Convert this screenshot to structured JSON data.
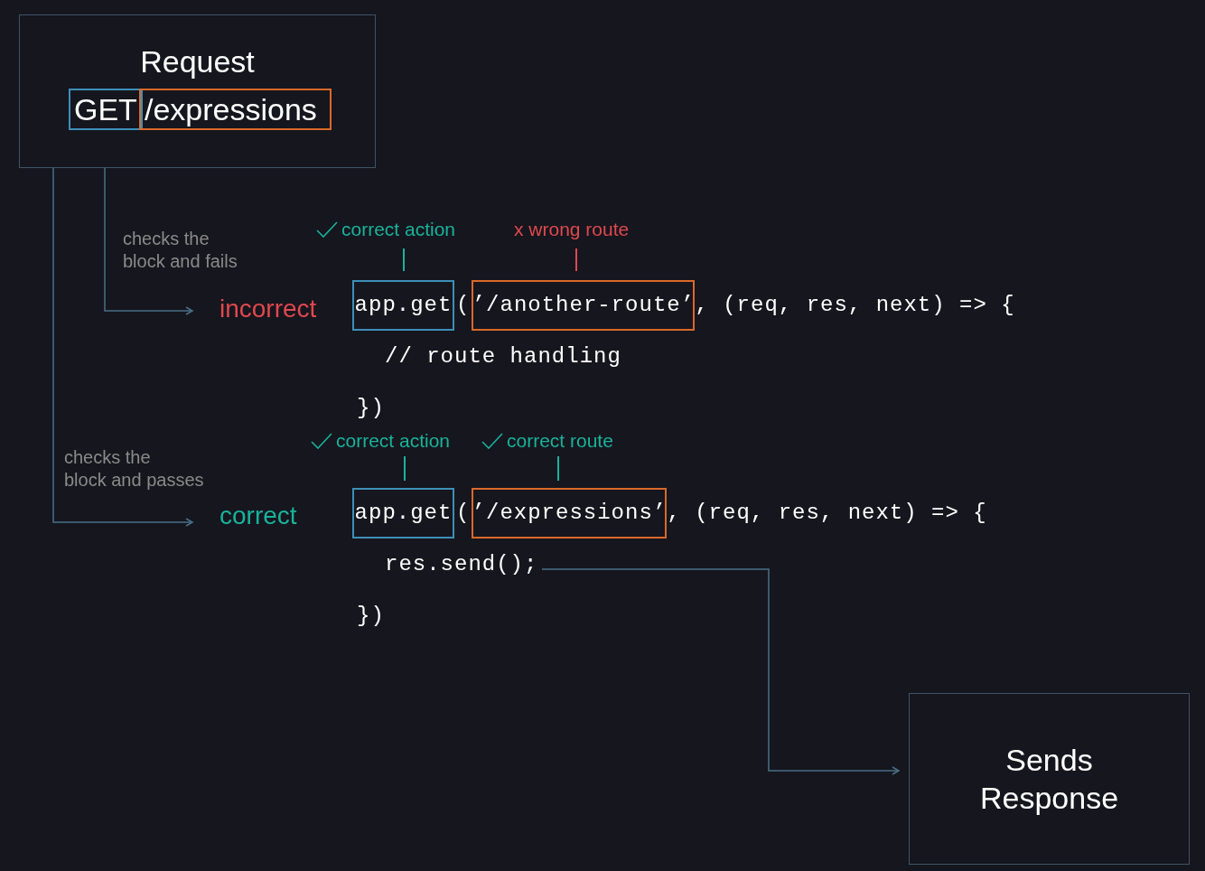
{
  "request": {
    "title": "Request",
    "method": "GET",
    "path": "/expressions"
  },
  "branches": [
    {
      "kind": "fail",
      "note_lines": [
        "checks the",
        "block and fails"
      ],
      "result": "incorrect",
      "annotations": [
        {
          "kind": "ok",
          "text": "correct action"
        },
        {
          "kind": "bad",
          "text": "x wrong route"
        }
      ],
      "code": {
        "action": "app.get",
        "paren": "(",
        "route": "’/another-route’",
        "rest": ", (req, res, next) => {",
        "body": "// route handling",
        "close": "})"
      }
    },
    {
      "kind": "pass",
      "note_lines": [
        "checks the",
        "block and passes"
      ],
      "result": "correct",
      "annotations": [
        {
          "kind": "ok",
          "text": "correct action"
        },
        {
          "kind": "ok",
          "text": "correct route"
        }
      ],
      "code": {
        "action": "app.get",
        "paren": "(",
        "route": "’/expressions’",
        "rest": ", (req, res, next) => {",
        "body": "res.send();",
        "close": "})"
      }
    }
  ],
  "response": {
    "title_lines": [
      "Sends",
      "Response"
    ]
  }
}
